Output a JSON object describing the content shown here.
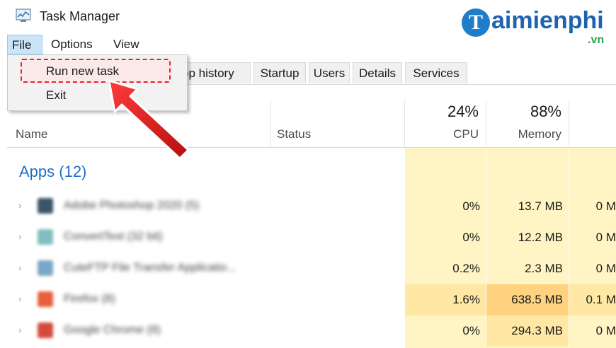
{
  "window": {
    "title": "Task Manager"
  },
  "logo": {
    "letter": "T",
    "brand": "aimienphi",
    "tld": ".vn"
  },
  "menu": {
    "file": "File",
    "options": "Options",
    "view": "View"
  },
  "dropdown": {
    "run_new_task": "Run new task",
    "exit": "Exit"
  },
  "tabs": [
    "pp history",
    "Startup",
    "Users",
    "Details",
    "Services"
  ],
  "columns": {
    "name": "Name",
    "status": "Status",
    "cpu_percent": "24%",
    "cpu_label": "CPU",
    "memory_percent": "88%",
    "memory_label": "Memory"
  },
  "apps_heading": "Apps (12)",
  "rows": [
    {
      "name": "Adobe Photoshop 2020 (5)",
      "cpu": "0%",
      "memory": "13.7 MB",
      "disk": "0 M",
      "icon": "photoshop-icon",
      "icon_color": "#3a5566"
    },
    {
      "name": "ConvertText (32 bit)",
      "cpu": "0%",
      "memory": "12.2 MB",
      "disk": "0 M",
      "icon": "convert-icon",
      "icon_color": "#7fbfbf"
    },
    {
      "name": "CuteFTP File Transfer Applicatio...",
      "cpu": "0.2%",
      "memory": "2.3 MB",
      "disk": "0 M",
      "icon": "ftp-icon",
      "icon_color": "#7aa7c7"
    },
    {
      "name": "Firefox (8)",
      "cpu": "1.6%",
      "memory": "638.5 MB",
      "disk": "0.1 M",
      "icon": "firefox-icon",
      "icon_color": "#e8603a"
    },
    {
      "name": "Google Chrome (8)",
      "cpu": "0%",
      "memory": "294.3 MB",
      "disk": "0 M",
      "icon": "chrome-icon",
      "icon_color": "#d44b3c"
    }
  ],
  "colors": {
    "accent": "#1e6fc8",
    "highlight": "#e8252a",
    "heat_light": "#fff4c4",
    "heat_mid": "#ffe8a3",
    "heat_strong": "#ffd27f"
  }
}
